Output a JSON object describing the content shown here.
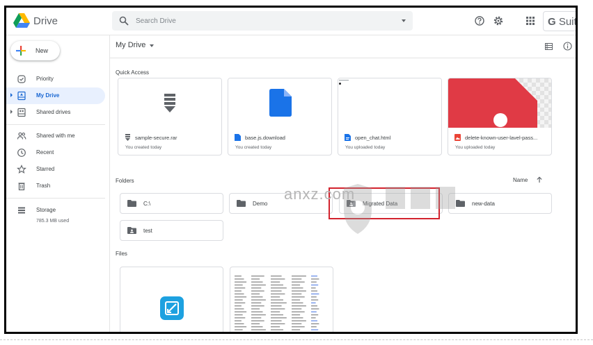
{
  "app": {
    "title": "Drive",
    "suite_brand_g": "G",
    "suite_brand_rest": " Suite"
  },
  "search": {
    "placeholder": "Search Drive"
  },
  "sidebar": {
    "new_label": "New",
    "items": [
      {
        "label": "Priority",
        "icon": "check-circle-icon"
      },
      {
        "label": "My Drive",
        "icon": "my-drive-icon",
        "active": true
      },
      {
        "label": "Shared drives",
        "icon": "shared-drives-icon"
      },
      {
        "label": "Shared with me",
        "icon": "people-icon"
      },
      {
        "label": "Recent",
        "icon": "clock-icon"
      },
      {
        "label": "Starred",
        "icon": "star-icon"
      },
      {
        "label": "Trash",
        "icon": "trash-icon"
      },
      {
        "label": "Storage",
        "icon": "storage-icon"
      }
    ],
    "storage_used": "785.3 MB used"
  },
  "main": {
    "breadcrumb": "My Drive",
    "quick_access_label": "Quick Access",
    "quick_access": [
      {
        "name": "sample-secure.rar",
        "sub": "You created today",
        "type": "archive"
      },
      {
        "name": "base.js.download",
        "sub": "You created today",
        "type": "doc"
      },
      {
        "name": "open_chat.html",
        "sub": "You uploaded today",
        "type": "doc"
      },
      {
        "name": "delete-known-user-lavel-pass...",
        "sub": "You uploaded today",
        "type": "image"
      }
    ],
    "folders_label": "Folders",
    "sort_label": "Name",
    "folders": [
      {
        "name": "C:\\",
        "icon": "folder-icon"
      },
      {
        "name": "Demo",
        "icon": "folder-icon"
      },
      {
        "name": "Migrated Data",
        "icon": "shared-folder-icon"
      },
      {
        "name": "new-data",
        "icon": "folder-icon"
      },
      {
        "name": "test",
        "icon": "shared-folder-icon"
      }
    ],
    "files_label": "Files"
  },
  "watermark": {
    "text": "anxz.com"
  },
  "colors": {
    "accent": "#1967d2",
    "highlight": "#d2222d",
    "red_image": "#e03a45"
  }
}
